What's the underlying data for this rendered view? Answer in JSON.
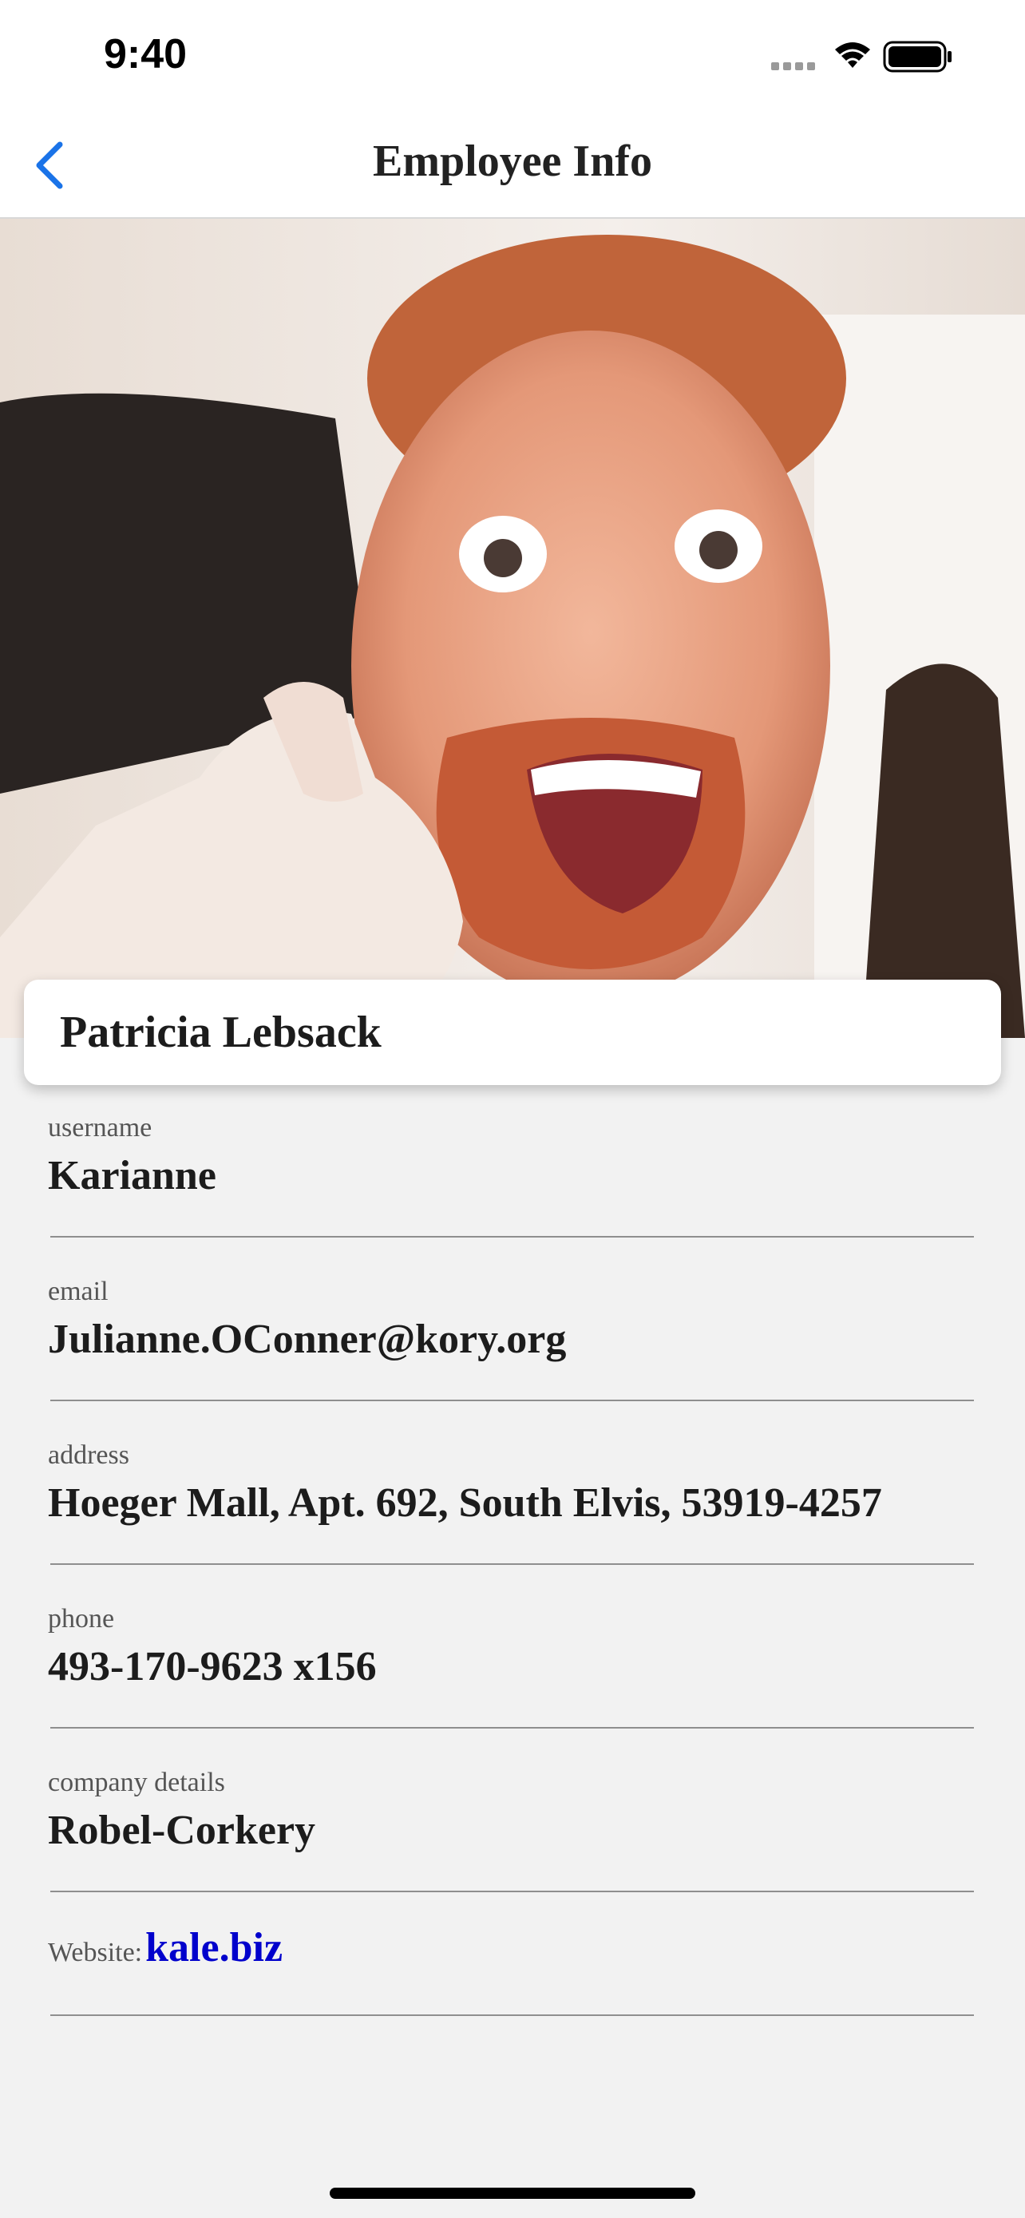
{
  "status_bar": {
    "time": "9:40",
    "icons": [
      "cellular-signal-icon",
      "wifi-icon",
      "battery-icon"
    ]
  },
  "nav": {
    "title": "Employee Info",
    "back_icon": "chevron-left-icon",
    "accent_color": "#1a73e8"
  },
  "profile": {
    "name": "Patricia Lebsack",
    "photo_description": "close-up of a red-haired bearded man giving a thumbs up"
  },
  "fields": [
    {
      "label": "username",
      "value": "Karianne"
    },
    {
      "label": "email",
      "value": "Julianne.OConner@kory.org"
    },
    {
      "label": "address",
      "value": "Hoeger Mall, Apt. 692, South Elvis, 53919-4257"
    },
    {
      "label": "phone",
      "value": "493-170-9623 x156"
    },
    {
      "label": "company details",
      "value": "Robel-Corkery"
    }
  ],
  "website": {
    "label": "Website:",
    "value": "kale.biz",
    "link_color": "#0000cc"
  }
}
